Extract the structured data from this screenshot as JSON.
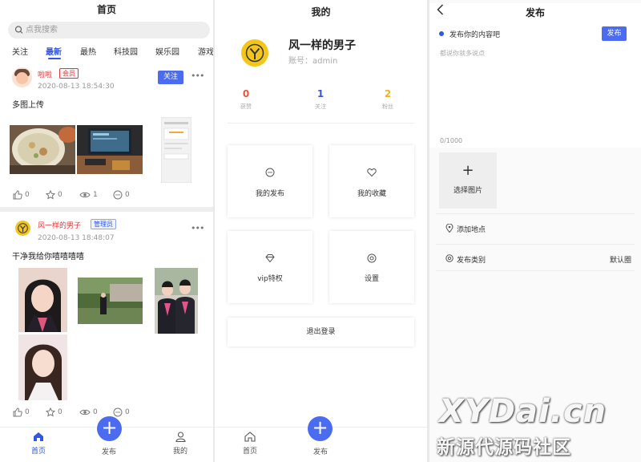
{
  "feed": {
    "title": "首页",
    "search_placeholder": "点我搜索",
    "tabs": [
      "关注",
      "最新",
      "最热",
      "科技园",
      "娱乐园",
      "游戏"
    ],
    "active_tab": "最新",
    "posts": [
      {
        "author": "啦啦",
        "badge": "会员",
        "time": "2020-08-13 18:54:30",
        "follow_label": "关注",
        "text": "多图上传",
        "likes": "0",
        "favorites": "0",
        "views": "1",
        "comments": "0"
      },
      {
        "author": "风一样的男子",
        "badge": "管理员",
        "time": "2020-08-13 18:48:07",
        "text": "干净我给你嘻嘻嘻嘻",
        "likes": "0",
        "favorites": "0",
        "views": "0",
        "comments": "0"
      }
    ],
    "tabbar": {
      "home": "首页",
      "publish": "发布",
      "mine": "我的"
    }
  },
  "profile": {
    "title": "我的",
    "name": "风一样的男子",
    "account": "账号：admin",
    "stats": [
      {
        "value": "0",
        "label": "获赞",
        "color": "#e8553a"
      },
      {
        "value": "1",
        "label": "关注",
        "color": "#3b57d6"
      },
      {
        "value": "2",
        "label": "粉丝",
        "color": "#f0b31f"
      }
    ],
    "grid": [
      "我的发布",
      "我的收藏",
      "vip特权",
      "设置"
    ],
    "logout": "退出登录",
    "tabbar": {
      "home": "首页",
      "publish": "发布"
    }
  },
  "publish": {
    "title": "发布",
    "hint": "发布你的内容吧",
    "button": "发布",
    "input_placeholder": "都说你就多说点",
    "counter": "0/1000",
    "pick_image": "选择图片",
    "location": "添加地点",
    "category_label": "发布类别",
    "category_value": "默认圈"
  },
  "watermark": {
    "line1": "XYDai.cn",
    "line2": "新源代源码社区"
  },
  "colors": {
    "accent": "#4b6cf0",
    "danger": "#e0363a",
    "logo": "#f4c51b"
  }
}
